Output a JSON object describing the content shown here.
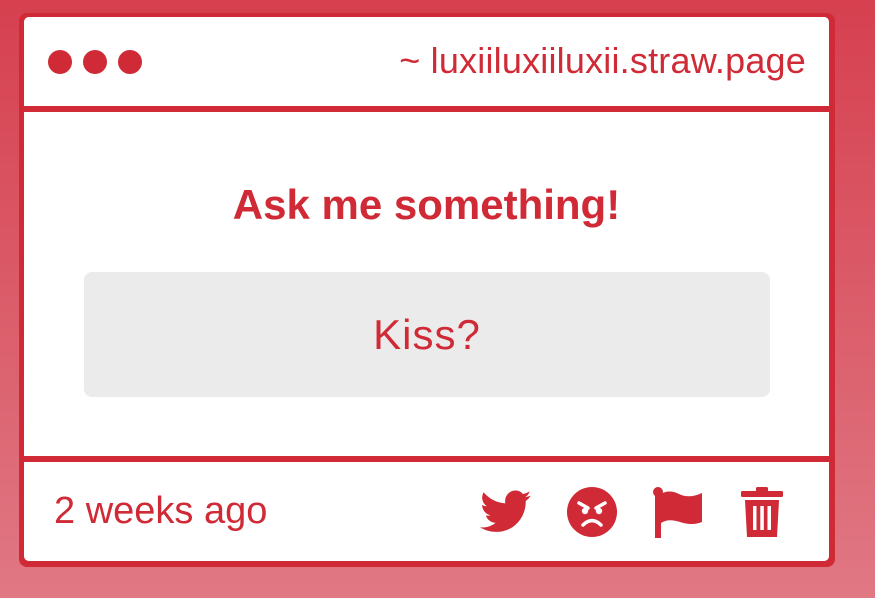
{
  "titlebar": {
    "url": "~ luxiiluxiiluxii.straw.page"
  },
  "main": {
    "heading": "Ask me something!",
    "question": "Kiss?"
  },
  "footer": {
    "timestamp": "2 weeks ago",
    "actions": [
      {
        "icon": "twitter-bird-icon"
      },
      {
        "icon": "angry-face-icon"
      },
      {
        "icon": "flag-icon"
      },
      {
        "icon": "trash-icon"
      }
    ]
  },
  "colors": {
    "accent": "#cf2a35",
    "question_bg": "#ecebeb",
    "background_top": "#d6404f",
    "background_bottom": "#e07884"
  }
}
